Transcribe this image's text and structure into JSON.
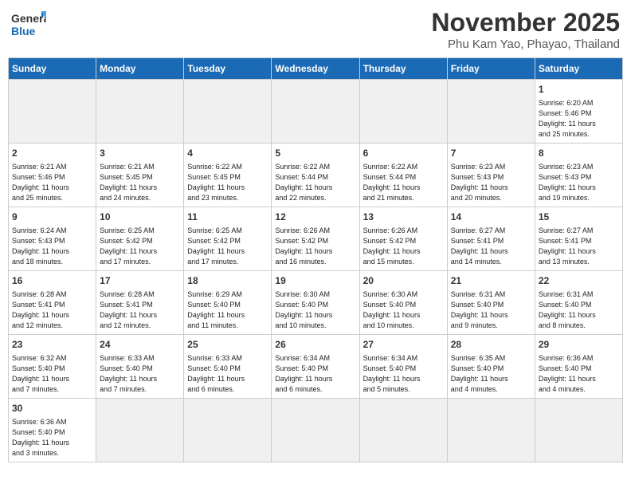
{
  "header": {
    "logo_general": "General",
    "logo_blue": "Blue",
    "month": "November 2025",
    "location": "Phu Kam Yao, Phayao, Thailand"
  },
  "days_of_week": [
    "Sunday",
    "Monday",
    "Tuesday",
    "Wednesday",
    "Thursday",
    "Friday",
    "Saturday"
  ],
  "weeks": [
    [
      {
        "num": "",
        "info": ""
      },
      {
        "num": "",
        "info": ""
      },
      {
        "num": "",
        "info": ""
      },
      {
        "num": "",
        "info": ""
      },
      {
        "num": "",
        "info": ""
      },
      {
        "num": "",
        "info": ""
      },
      {
        "num": "1",
        "info": "Sunrise: 6:20 AM\nSunset: 5:46 PM\nDaylight: 11 hours\nand 25 minutes."
      }
    ],
    [
      {
        "num": "2",
        "info": "Sunrise: 6:21 AM\nSunset: 5:46 PM\nDaylight: 11 hours\nand 25 minutes."
      },
      {
        "num": "3",
        "info": "Sunrise: 6:21 AM\nSunset: 5:45 PM\nDaylight: 11 hours\nand 24 minutes."
      },
      {
        "num": "4",
        "info": "Sunrise: 6:22 AM\nSunset: 5:45 PM\nDaylight: 11 hours\nand 23 minutes."
      },
      {
        "num": "5",
        "info": "Sunrise: 6:22 AM\nSunset: 5:44 PM\nDaylight: 11 hours\nand 22 minutes."
      },
      {
        "num": "6",
        "info": "Sunrise: 6:22 AM\nSunset: 5:44 PM\nDaylight: 11 hours\nand 21 minutes."
      },
      {
        "num": "7",
        "info": "Sunrise: 6:23 AM\nSunset: 5:43 PM\nDaylight: 11 hours\nand 20 minutes."
      },
      {
        "num": "8",
        "info": "Sunrise: 6:23 AM\nSunset: 5:43 PM\nDaylight: 11 hours\nand 19 minutes."
      }
    ],
    [
      {
        "num": "9",
        "info": "Sunrise: 6:24 AM\nSunset: 5:43 PM\nDaylight: 11 hours\nand 18 minutes."
      },
      {
        "num": "10",
        "info": "Sunrise: 6:25 AM\nSunset: 5:42 PM\nDaylight: 11 hours\nand 17 minutes."
      },
      {
        "num": "11",
        "info": "Sunrise: 6:25 AM\nSunset: 5:42 PM\nDaylight: 11 hours\nand 17 minutes."
      },
      {
        "num": "12",
        "info": "Sunrise: 6:26 AM\nSunset: 5:42 PM\nDaylight: 11 hours\nand 16 minutes."
      },
      {
        "num": "13",
        "info": "Sunrise: 6:26 AM\nSunset: 5:42 PM\nDaylight: 11 hours\nand 15 minutes."
      },
      {
        "num": "14",
        "info": "Sunrise: 6:27 AM\nSunset: 5:41 PM\nDaylight: 11 hours\nand 14 minutes."
      },
      {
        "num": "15",
        "info": "Sunrise: 6:27 AM\nSunset: 5:41 PM\nDaylight: 11 hours\nand 13 minutes."
      }
    ],
    [
      {
        "num": "16",
        "info": "Sunrise: 6:28 AM\nSunset: 5:41 PM\nDaylight: 11 hours\nand 12 minutes."
      },
      {
        "num": "17",
        "info": "Sunrise: 6:28 AM\nSunset: 5:41 PM\nDaylight: 11 hours\nand 12 minutes."
      },
      {
        "num": "18",
        "info": "Sunrise: 6:29 AM\nSunset: 5:40 PM\nDaylight: 11 hours\nand 11 minutes."
      },
      {
        "num": "19",
        "info": "Sunrise: 6:30 AM\nSunset: 5:40 PM\nDaylight: 11 hours\nand 10 minutes."
      },
      {
        "num": "20",
        "info": "Sunrise: 6:30 AM\nSunset: 5:40 PM\nDaylight: 11 hours\nand 10 minutes."
      },
      {
        "num": "21",
        "info": "Sunrise: 6:31 AM\nSunset: 5:40 PM\nDaylight: 11 hours\nand 9 minutes."
      },
      {
        "num": "22",
        "info": "Sunrise: 6:31 AM\nSunset: 5:40 PM\nDaylight: 11 hours\nand 8 minutes."
      }
    ],
    [
      {
        "num": "23",
        "info": "Sunrise: 6:32 AM\nSunset: 5:40 PM\nDaylight: 11 hours\nand 7 minutes."
      },
      {
        "num": "24",
        "info": "Sunrise: 6:33 AM\nSunset: 5:40 PM\nDaylight: 11 hours\nand 7 minutes."
      },
      {
        "num": "25",
        "info": "Sunrise: 6:33 AM\nSunset: 5:40 PM\nDaylight: 11 hours\nand 6 minutes."
      },
      {
        "num": "26",
        "info": "Sunrise: 6:34 AM\nSunset: 5:40 PM\nDaylight: 11 hours\nand 6 minutes."
      },
      {
        "num": "27",
        "info": "Sunrise: 6:34 AM\nSunset: 5:40 PM\nDaylight: 11 hours\nand 5 minutes."
      },
      {
        "num": "28",
        "info": "Sunrise: 6:35 AM\nSunset: 5:40 PM\nDaylight: 11 hours\nand 4 minutes."
      },
      {
        "num": "29",
        "info": "Sunrise: 6:36 AM\nSunset: 5:40 PM\nDaylight: 11 hours\nand 4 minutes."
      }
    ],
    [
      {
        "num": "30",
        "info": "Sunrise: 6:36 AM\nSunset: 5:40 PM\nDaylight: 11 hours\nand 3 minutes."
      },
      {
        "num": "",
        "info": ""
      },
      {
        "num": "",
        "info": ""
      },
      {
        "num": "",
        "info": ""
      },
      {
        "num": "",
        "info": ""
      },
      {
        "num": "",
        "info": ""
      },
      {
        "num": "",
        "info": ""
      }
    ]
  ]
}
